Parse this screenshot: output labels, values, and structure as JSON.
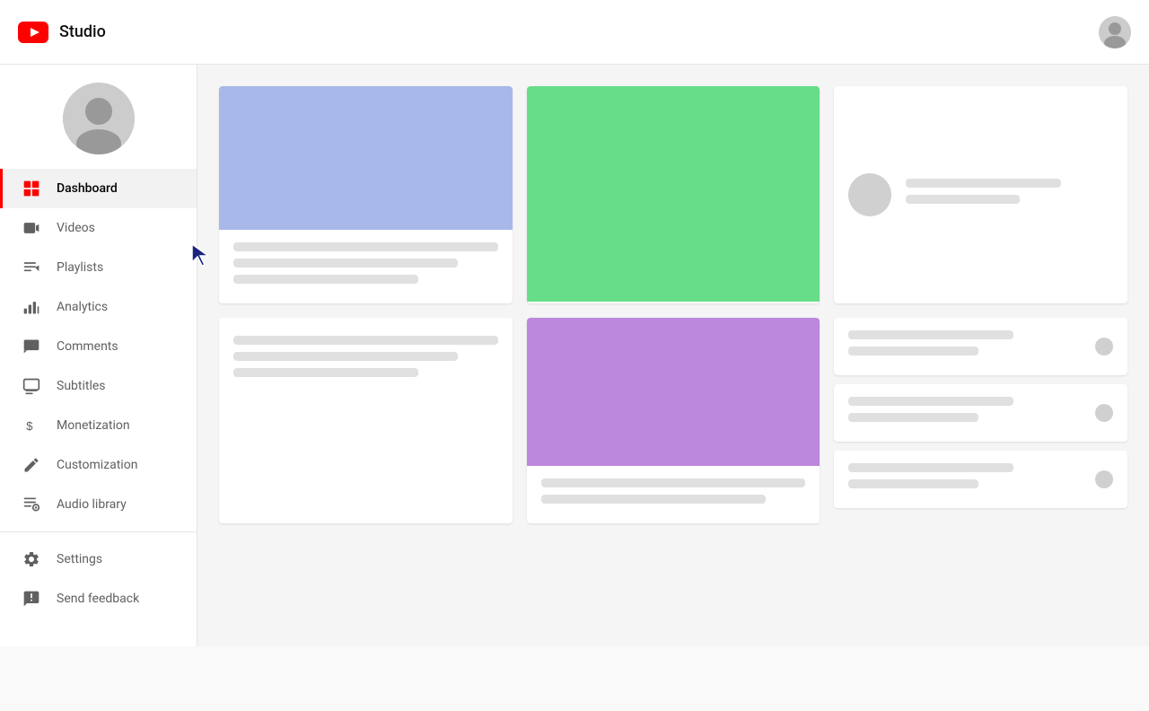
{
  "header": {
    "logo_text": "Studio",
    "logo_alt": "YouTube Studio"
  },
  "sidebar": {
    "nav_items": [
      {
        "id": "dashboard",
        "label": "Dashboard",
        "icon": "dashboard-icon",
        "active": true
      },
      {
        "id": "videos",
        "label": "Videos",
        "icon": "videos-icon",
        "active": false
      },
      {
        "id": "playlists",
        "label": "Playlists",
        "icon": "playlists-icon",
        "active": false
      },
      {
        "id": "analytics",
        "label": "Analytics",
        "icon": "analytics-icon",
        "active": false
      },
      {
        "id": "comments",
        "label": "Comments",
        "icon": "comments-icon",
        "active": false
      },
      {
        "id": "subtitles",
        "label": "Subtitles",
        "icon": "subtitles-icon",
        "active": false
      },
      {
        "id": "monetization",
        "label": "Monetization",
        "icon": "monetization-icon",
        "active": false
      },
      {
        "id": "customization",
        "label": "Customization",
        "icon": "customization-icon",
        "active": false
      },
      {
        "id": "audio-library",
        "label": "Audio library",
        "icon": "audio-library-icon",
        "active": false
      }
    ],
    "bottom_items": [
      {
        "id": "settings",
        "label": "Settings",
        "icon": "settings-icon"
      },
      {
        "id": "send-feedback",
        "label": "Send feedback",
        "icon": "feedback-icon"
      }
    ]
  },
  "cards": {
    "card1_bg": "#a8b8e8",
    "card2_bg": "#66dd88",
    "card3_bg": "#bb88dd"
  }
}
